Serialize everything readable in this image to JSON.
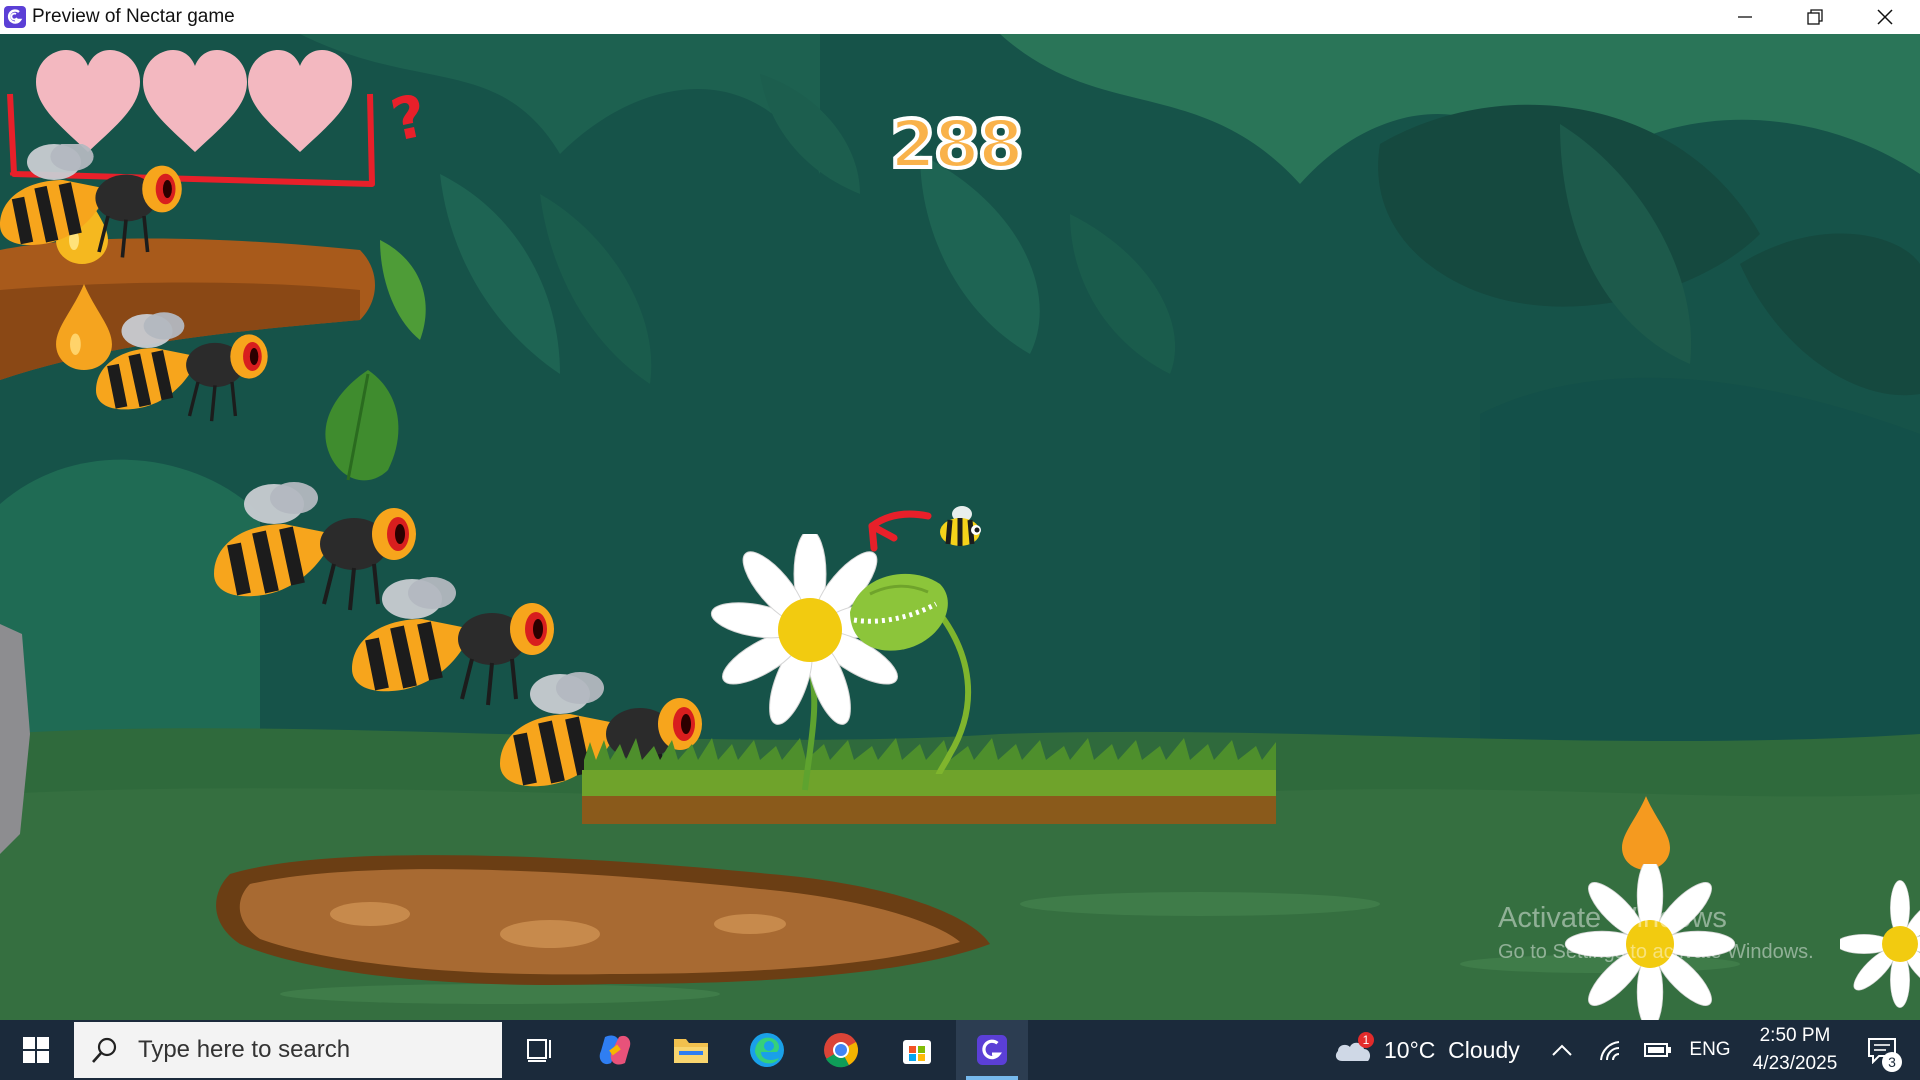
{
  "window": {
    "title": "Preview of Nectar game",
    "icon": "gdevelop-logo-icon"
  },
  "hud": {
    "lives": 3,
    "score": "288",
    "annotation_mark": "?"
  },
  "watermark": {
    "line1": "Activate Windows",
    "line2": "Go to Settings to activate Windows."
  },
  "taskbar": {
    "search_placeholder": "Type here to search",
    "weather": {
      "badge": "1",
      "text": "10°C  Cloudy"
    },
    "language": "ENG",
    "time": "2:50 PM",
    "date": "4/23/2025",
    "notifications": "3"
  },
  "colors": {
    "heart": "#f3b8c0",
    "score_fill": "#f9b24a",
    "annotation_red": "#e8202a",
    "platform_grass": "#6fa32b",
    "platform_dirt": "#8a5a1b",
    "taskbar": "#1b2a3b"
  }
}
